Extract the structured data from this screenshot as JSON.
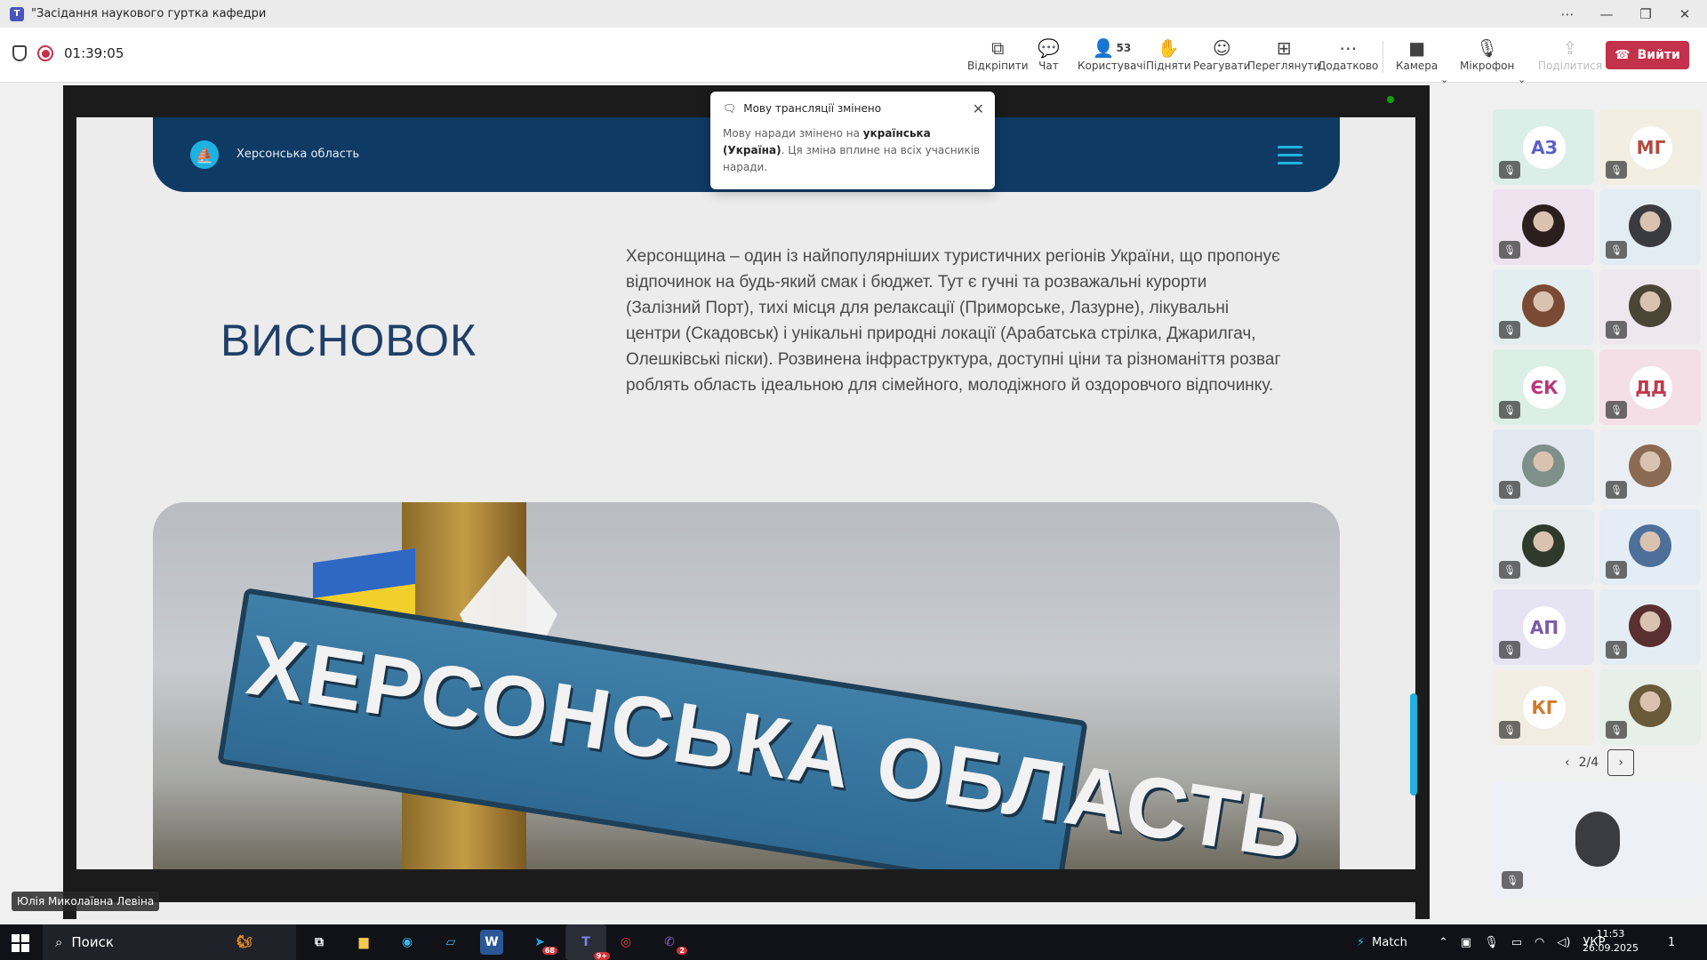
{
  "window": {
    "title": "\"Засідання наукового гуртка кафедри",
    "controls": [
      "⋯",
      "—",
      "❐",
      "✕"
    ]
  },
  "meeting": {
    "timer": "01:39:05",
    "buttons": [
      {
        "label": "Відкріпити",
        "icon": "unpin-icon"
      },
      {
        "label": "Чат",
        "icon": "chat-icon"
      },
      {
        "label": "Користувачі",
        "icon": "people-icon",
        "count": "53"
      },
      {
        "label": "Підняти",
        "icon": "raise-hand-icon"
      },
      {
        "label": "Реагувати",
        "icon": "emoji-icon"
      },
      {
        "label": "Переглянути",
        "icon": "view-icon"
      },
      {
        "label": "Додатково",
        "icon": "more-icon"
      },
      {
        "label": "Камера",
        "icon": "camera-off-icon"
      },
      {
        "label": "Мікрофон",
        "icon": "mic-off-icon"
      },
      {
        "label": "Поділитися",
        "icon": "share-icon"
      }
    ],
    "leave_label": "Вийти"
  },
  "toast": {
    "title": "Мову трансляції змінено",
    "body_prefix": "Мову наради змінено на ",
    "body_bold": "українська (Україна)",
    "body_suffix": ". Ця зміна вплине на всіх учасників наради."
  },
  "slide": {
    "region": "Херсонська область",
    "heading": "ВИСНОВОК",
    "text": "Херсонщина – один із найпопулярніших туристичних регіонів України, що пропонує відпочинок на будь-який смак і бюджет. Тут є гучні та розважальні курорти (Залізний Порт), тихі місця для релаксації (Приморське, Лазурне), лікувальні центри (Скадовськ) і унікальні природні локації (Арабатська стрілка, Джарилгач, Олешківські піски). Розвинена інфраструктура, доступні ціни та різноманіття розваг роблять область ідеальною для сімейного, молодіжного й оздоровчого відпочинку.",
    "sign_text": "ХЕРСОНСЬКА ОБЛАСТЬ"
  },
  "presenter": "Юлія Миколаївна Левіна",
  "participants": [
    {
      "initials": "АЗ",
      "color": "#5b5fc7"
    },
    {
      "initials": "МГ",
      "color": "#b24a3f"
    },
    {
      "initials": "",
      "color": "#2a1f1c"
    },
    {
      "initials": "",
      "color": "#3a3b40"
    },
    {
      "initials": "",
      "color": "#7a4a34"
    },
    {
      "initials": "",
      "color": "#4b4536"
    },
    {
      "initials": "ЄК",
      "color": "#b8387a"
    },
    {
      "initials": "ДД",
      "color": "#c23b4a"
    },
    {
      "initials": "",
      "color": "#7f8f8a"
    },
    {
      "initials": "",
      "color": "#8a6a52"
    },
    {
      "initials": "",
      "color": "#2f3a2c"
    },
    {
      "initials": "",
      "color": "#4d6f9a"
    },
    {
      "initials": "АП",
      "color": "#7b5aa8"
    },
    {
      "initials": "",
      "color": "#5a2f2f"
    },
    {
      "initials": "КГ",
      "color": "#d07a2a"
    },
    {
      "initials": "",
      "color": "#6a5a3a"
    }
  ],
  "pager": {
    "text": "2/4"
  },
  "taskbar": {
    "search_label": "Поиск",
    "weather": "Match",
    "lang": "УКР",
    "time": "11:53",
    "date": "26.09.2025",
    "notif_count": "1",
    "telegram_badge": "68",
    "teams_badge": "9+",
    "viber_badge": "2"
  }
}
